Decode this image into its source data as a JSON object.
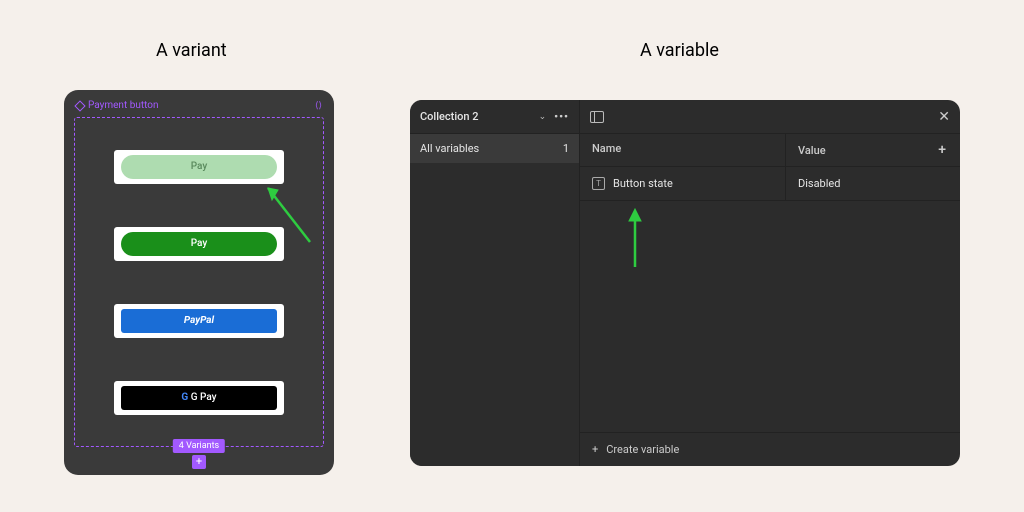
{
  "headings": {
    "variant": "A variant",
    "variable": "A variable"
  },
  "variant_panel": {
    "component_name": "Payment button",
    "variants_badge": "4 Variants",
    "variants": [
      {
        "label": "Pay"
      },
      {
        "label": "Pay"
      },
      {
        "label": "PayPal"
      },
      {
        "label": "G Pay",
        "brand": "gpay"
      }
    ]
  },
  "variable_panel": {
    "collection": "Collection 2",
    "sidebar": {
      "all_variables_label": "All variables",
      "all_variables_count": "1"
    },
    "columns": {
      "name": "Name",
      "value": "Value"
    },
    "rows": [
      {
        "name": "Button state",
        "value": "Disabled"
      }
    ],
    "create_label": "Create variable"
  }
}
